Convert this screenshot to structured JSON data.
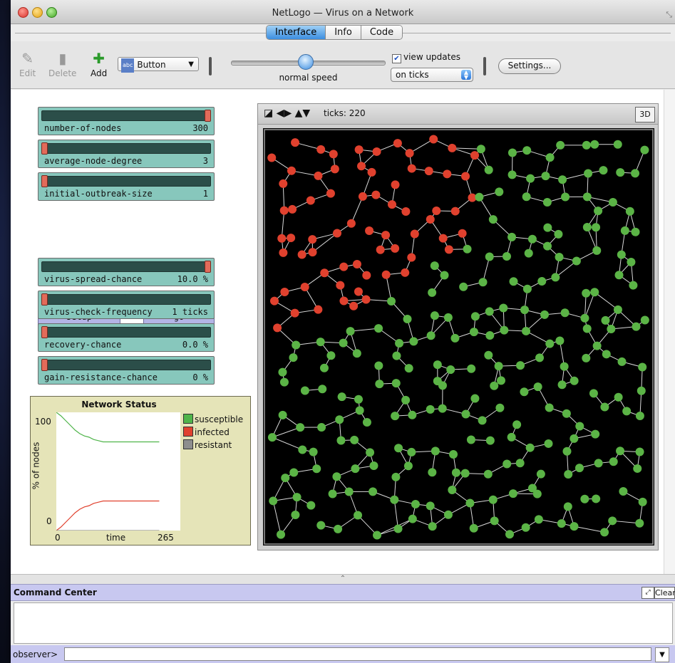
{
  "window": {
    "title": "NetLogo — Virus on a Network"
  },
  "tabs": [
    {
      "label": "Interface",
      "active": true
    },
    {
      "label": "Info",
      "active": false
    },
    {
      "label": "Code",
      "active": false
    }
  ],
  "toolbar": {
    "edit_label": "Edit",
    "delete_label": "Delete",
    "add_label": "Add",
    "widget_type": "Button",
    "widget_type_badge": "abc",
    "speed_label": "normal speed",
    "speed_fraction": 0.5,
    "view_updates_label": "view updates",
    "view_updates_checked": true,
    "update_mode": "on ticks",
    "settings_label": "Settings..."
  },
  "sliders": [
    {
      "name": "number-of-nodes",
      "value": "300",
      "fraction": 1.0
    },
    {
      "name": "average-node-degree",
      "value": "3",
      "fraction": 0.0
    },
    {
      "name": "initial-outbreak-size",
      "value": "1",
      "fraction": 0.0
    },
    {
      "name": "virus-spread-chance",
      "value": "10.0 %",
      "fraction": 1.0
    },
    {
      "name": "virus-check-frequency",
      "value": "1 ticks",
      "fraction": 0.0
    },
    {
      "name": "recovery-chance",
      "value": "0.0 %",
      "fraction": 0.0
    },
    {
      "name": "gain-resistance-chance",
      "value": "0 %",
      "fraction": 0.0
    }
  ],
  "buttons": {
    "setup_label": "setup",
    "go_label": "go"
  },
  "plot": {
    "title": "Network Status",
    "ylabel": "% of nodes",
    "xlabel": "time",
    "x_min": "0",
    "x_max": "265",
    "y_min": "0",
    "y_max": "100",
    "legend": [
      {
        "name": "susceptible",
        "color": "#4fb44a"
      },
      {
        "name": "infected",
        "color": "#e0412e"
      },
      {
        "name": "resistant",
        "color": "#8e8e8e"
      }
    ]
  },
  "chart_data": {
    "type": "line",
    "title": "Network Status",
    "xlabel": "time",
    "ylabel": "% of nodes",
    "xlim": [
      0,
      265
    ],
    "ylim": [
      0,
      100
    ],
    "legend_placement": "right",
    "series": [
      {
        "name": "susceptible",
        "color": "#4fb44a",
        "x": [
          0,
          10,
          20,
          30,
          40,
          50,
          60,
          70,
          80,
          90,
          100,
          120,
          140,
          160,
          180,
          200,
          220
        ],
        "y": [
          100,
          97,
          93,
          89,
          85,
          82,
          80,
          79,
          77,
          76,
          75,
          75,
          75,
          75,
          75,
          75,
          75
        ]
      },
      {
        "name": "infected",
        "color": "#e0412e",
        "x": [
          0,
          10,
          20,
          30,
          40,
          50,
          60,
          70,
          80,
          90,
          100,
          120,
          140,
          160,
          180,
          200,
          220
        ],
        "y": [
          0,
          3,
          7,
          11,
          15,
          18,
          20,
          21,
          23,
          24,
          25,
          25,
          25,
          25,
          25,
          25,
          25
        ]
      },
      {
        "name": "resistant",
        "color": "#8e8e8e",
        "x": [
          0,
          220
        ],
        "y": [
          0,
          0
        ]
      }
    ]
  },
  "view": {
    "ticks_text": "ticks: 220",
    "three_d_label": "3D",
    "node_colors": {
      "susceptible": "#5bb446",
      "infected": "#e0412e"
    },
    "link_color": "#d8d8d8",
    "background": "#000000"
  },
  "command_center": {
    "title": "Command Center",
    "clear_label": "Clear",
    "prompt": "observer>",
    "input_value": ""
  }
}
